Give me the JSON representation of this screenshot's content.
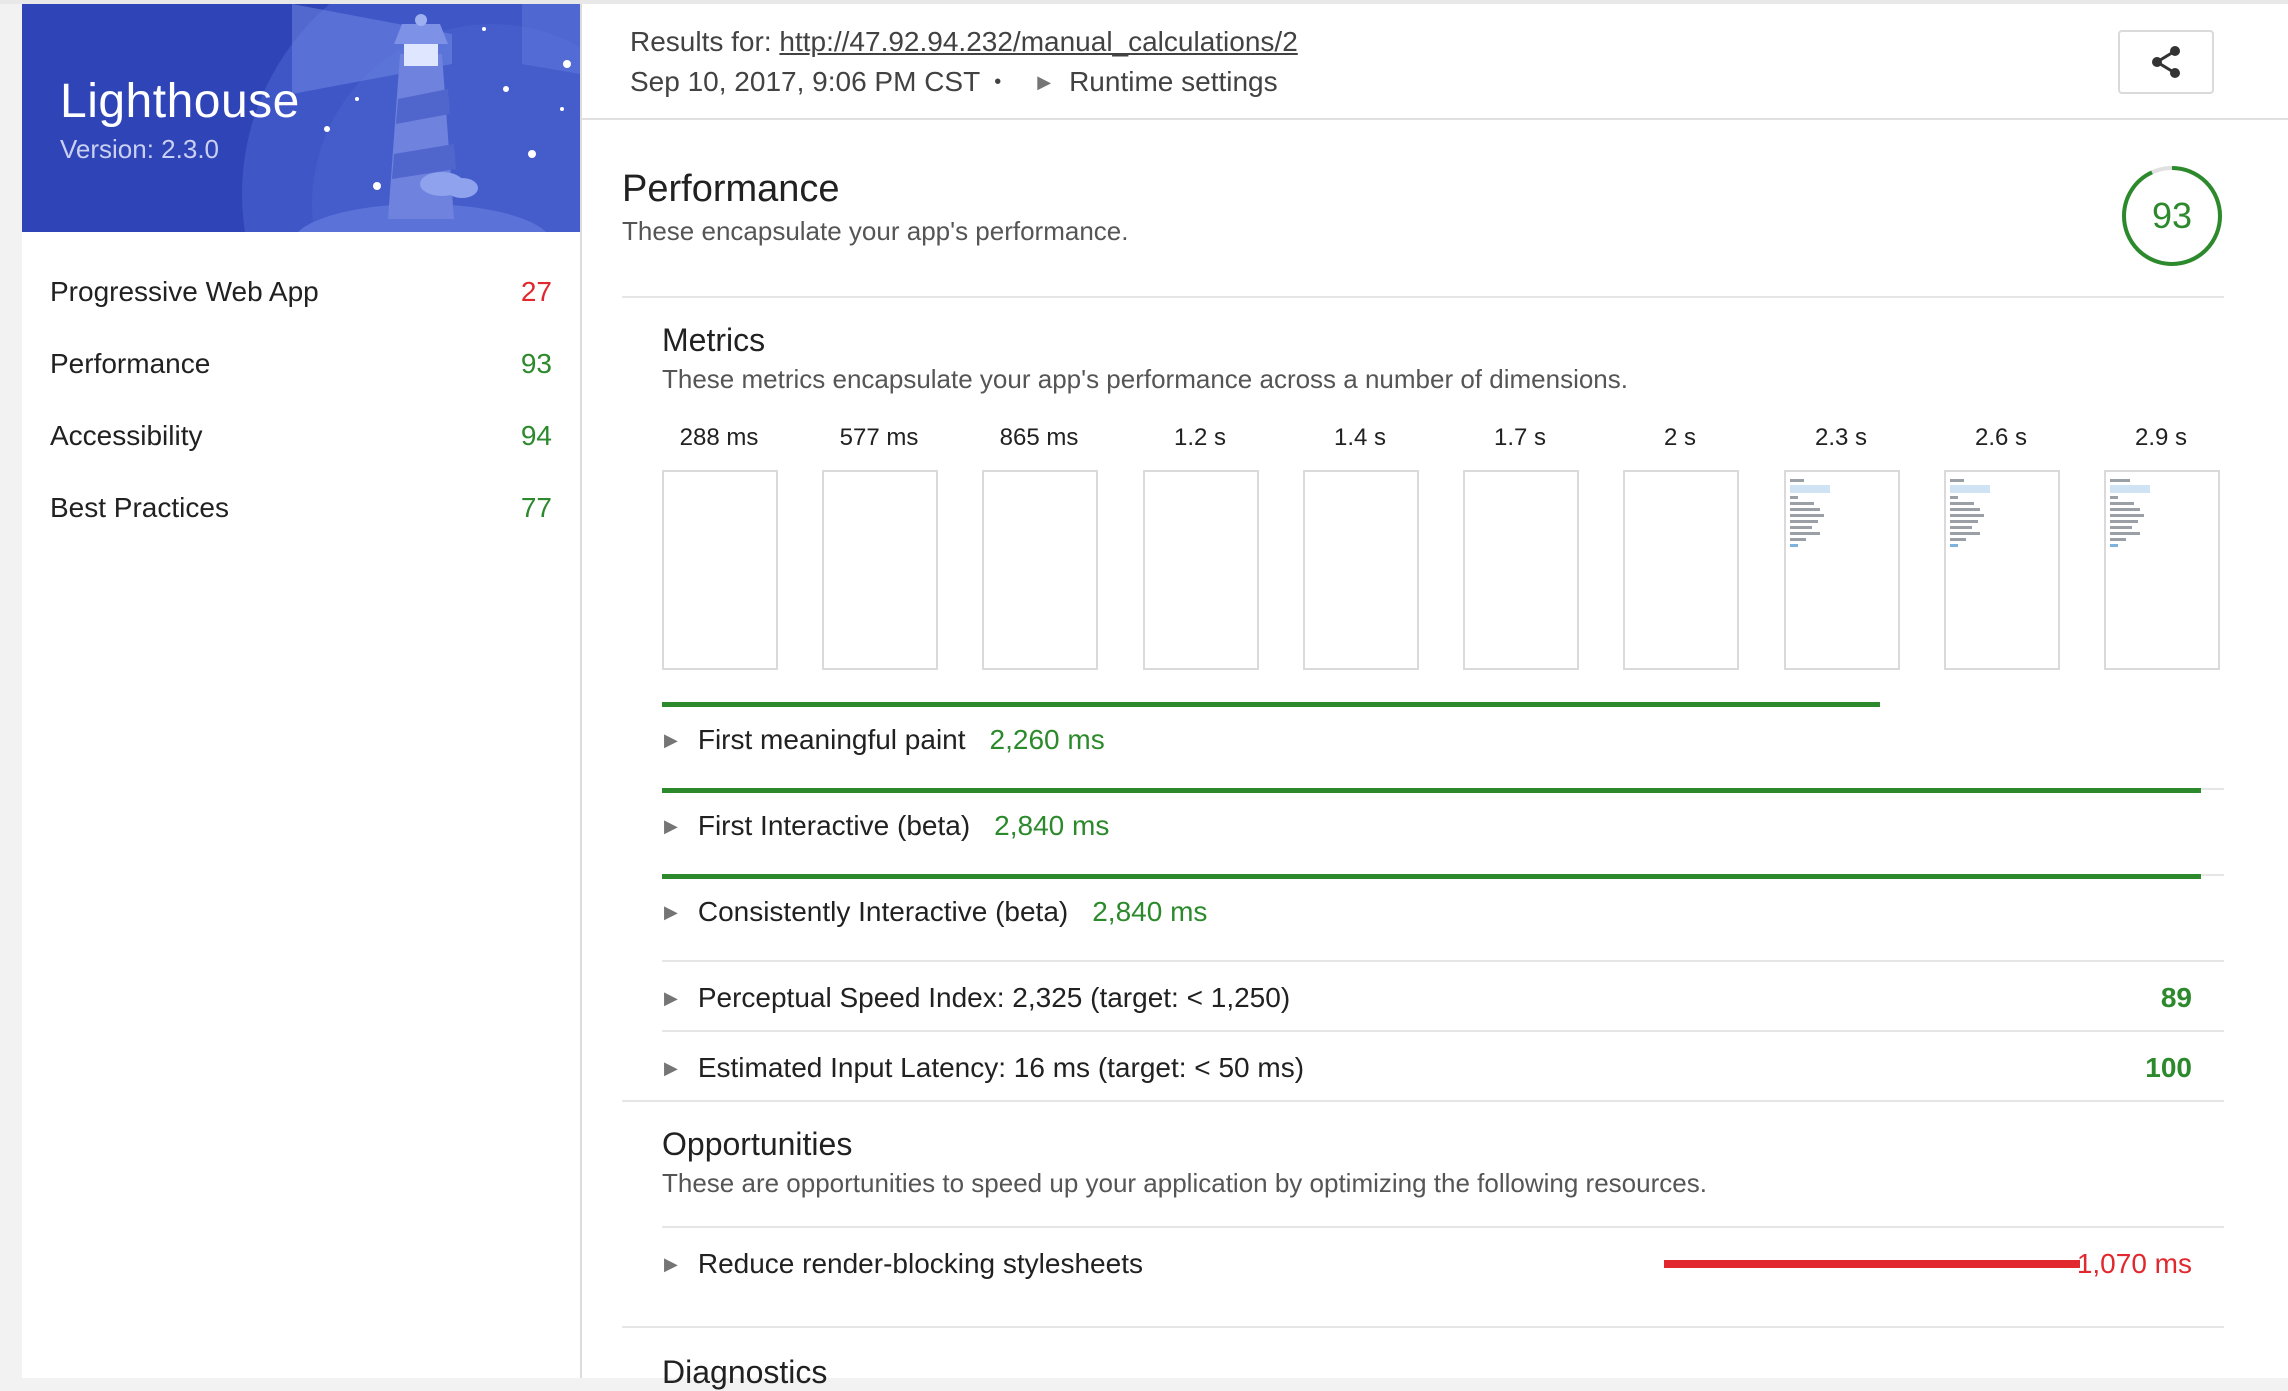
{
  "app": {
    "name": "Lighthouse",
    "version": "Version: 2.3.0"
  },
  "nav": [
    {
      "label": "Progressive Web App",
      "score": "27"
    },
    {
      "label": "Performance",
      "score": "93"
    },
    {
      "label": "Accessibility",
      "score": "94"
    },
    {
      "label": "Best Practices",
      "score": "77"
    }
  ],
  "header": {
    "results_prefix": "Results for: ",
    "url": "http://47.92.94.232/manual_calculations/2",
    "date": "Sep 10, 2017, 9:06 PM CST",
    "dot": "•",
    "runtime": "Runtime settings",
    "share_icon": "share-icon"
  },
  "performance": {
    "title": "Performance",
    "description": "These encapsulate your app's performance.",
    "score": "93",
    "score_fraction": 0.93,
    "metrics": {
      "title": "Metrics",
      "description": "These metrics encapsulate your app's performance across a number of dimensions.",
      "filmstrip": [
        "288 ms",
        "577 ms",
        "865 ms",
        "1.2 s",
        "1.4 s",
        "1.7 s",
        "2 s",
        "2.3 s",
        "2.6 s",
        "2.9 s"
      ],
      "timed": [
        {
          "label": "First meaningful paint",
          "value": "2,260 ms",
          "fraction": 0.78
        },
        {
          "label": "First Interactive (beta)",
          "value": "2,840 ms",
          "fraction": 0.985
        },
        {
          "label": "Consistently Interactive (beta)",
          "value": "2,840 ms",
          "fraction": 0.985
        }
      ],
      "scored": [
        {
          "label": "Perceptual Speed Index: 2,325 (target: < 1,250)",
          "score": "89"
        },
        {
          "label": "Estimated Input Latency: 16 ms (target: < 50 ms)",
          "score": "100"
        }
      ]
    },
    "opportunities": {
      "title": "Opportunities",
      "description": "These are opportunities to speed up your application by optimizing the following resources.",
      "items": [
        {
          "label": "Reduce render-blocking stylesheets",
          "value": "1,070 ms"
        }
      ]
    },
    "diagnostics": {
      "title": "Diagnostics"
    }
  },
  "colors": {
    "brand": "#2f44b6",
    "pass": "#2c8a2c",
    "fail": "#e0282e"
  }
}
